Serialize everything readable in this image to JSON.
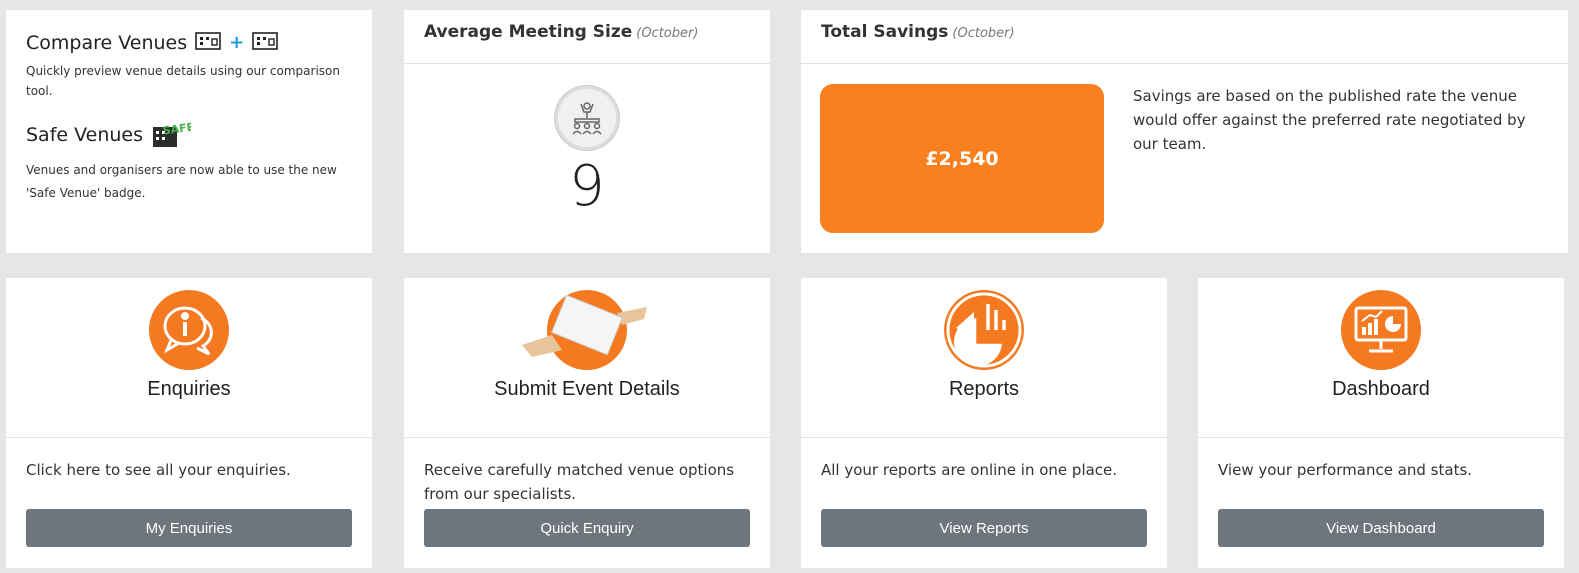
{
  "compare": {
    "title": "Compare Venues",
    "plus": "+",
    "desc": "Quickly preview venue details using our comparison tool."
  },
  "safe": {
    "title": "Safe Venues",
    "badge_text": "SAFE",
    "desc": "Venues and organisers are now able to use the new 'Safe Venue' badge."
  },
  "avg_meeting": {
    "title": "Average Meeting Size",
    "period": "(October)",
    "value": "9"
  },
  "savings": {
    "title": "Total Savings",
    "period": "(October)",
    "amount": "£2,540",
    "note": "Savings are based on the published rate the venue would offer against the preferred rate negotiated by our team."
  },
  "tiles": [
    {
      "icon": "info-chat-icon",
      "title": "Enquiries",
      "desc": "Click here to see all your enquiries.",
      "button": "My Enquiries"
    },
    {
      "icon": "handover-document-icon",
      "title": "Submit Event Details",
      "desc": "Receive carefully matched venue options from our specialists.",
      "button": "Quick Enquiry"
    },
    {
      "icon": "pie-chart-icon",
      "title": "Reports",
      "desc": "All your reports are online in one place.",
      "button": "View Reports"
    },
    {
      "icon": "monitor-stats-icon",
      "title": "Dashboard",
      "desc": "View your performance and stats.",
      "button": "View Dashboard"
    }
  ],
  "colors": {
    "accent": "#f47920",
    "savings_box": "#f9801f",
    "button": "#6e757c",
    "background": "#e6e6e6"
  }
}
